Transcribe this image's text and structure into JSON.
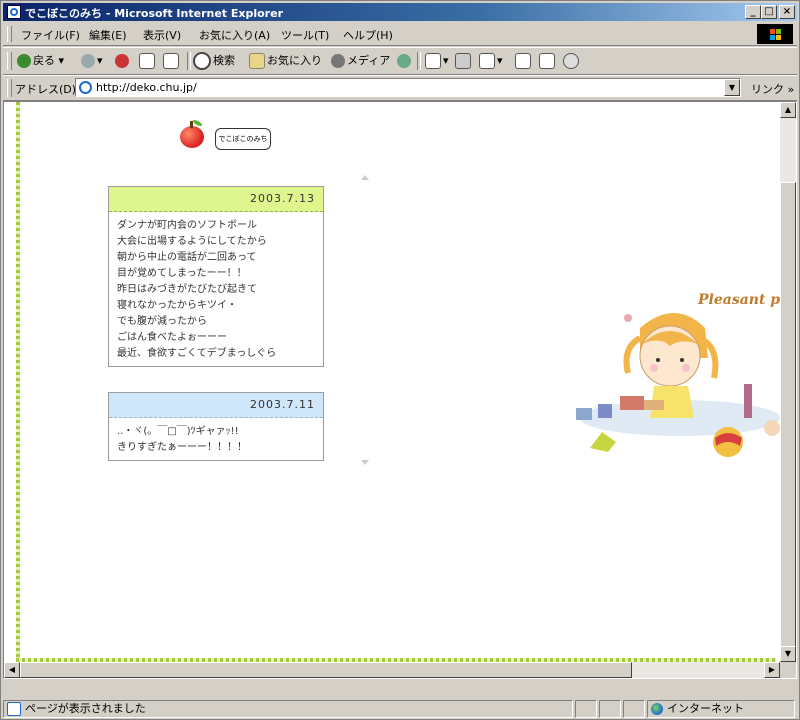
{
  "window": {
    "title": "でこぼこのみち - Microsoft Internet Explorer",
    "min": "_",
    "max": "□",
    "close": "×"
  },
  "menu": [
    "ファイル(F)",
    "編集(E)",
    "表示(V)",
    "お気に入り(A)",
    "ツール(T)",
    "ヘルプ(H)"
  ],
  "toolbar": {
    "back": "戻る",
    "search": "検索",
    "favorites": "お気に入り",
    "media": "メディア"
  },
  "address": {
    "label": "アドレス(D)",
    "url": "http://deko.chu.jp/",
    "links": "リンク »"
  },
  "page": {
    "logo_text": "でこぼこのみち",
    "entries": [
      {
        "date": "2003.7.13",
        "lines": [
          "ダンナが町内会のソフトボール",
          "大会に出場するようにしてたから",
          "朝から中止の電話が二回あって",
          "目が覚めてしまったーー！！",
          "昨日はみづきがたびたび起きて",
          "寝れなかったからキツイ・",
          "でも腹が減ったから",
          "ごはん食べたよぉーーー",
          "最近、食欲すごくてデブまっしぐら"
        ]
      },
      {
        "date": "2003.7.11",
        "lines": [
          "..・ヾ(。￣□￣)ﾂギャァｯ!!",
          "きりすぎたぁーーー！！！！"
        ]
      }
    ],
    "illustration_text": "Pleasant pla"
  },
  "status": {
    "text": "ページが表示されました",
    "zone": "インターネット"
  },
  "colors": {
    "titlebar": "#0a246a",
    "entry1_header": "#dff58d",
    "entry2_header": "#cfe6fb",
    "frame": "#a4c83c"
  }
}
